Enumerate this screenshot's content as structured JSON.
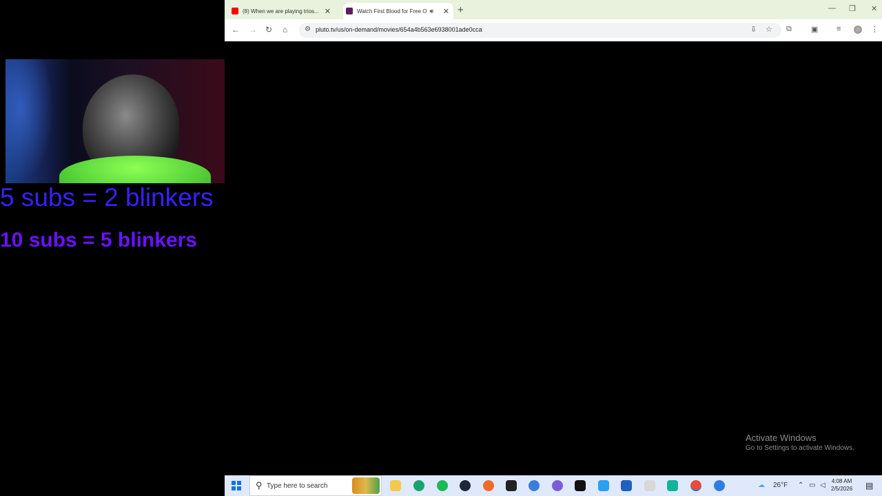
{
  "overlay": {
    "line1": "5 subs = 2 blinkers",
    "line2": "10 subs = 5 blinkers"
  },
  "browser": {
    "tabs": [
      {
        "title": "(8) When we are playing trios...",
        "favicon": "youtube-icon",
        "active": false
      },
      {
        "title": "Watch First Blood for Free O",
        "favicon": "pluto-tv-icon",
        "active": true
      }
    ],
    "address": "pluto.tv/us/on-demand/movies/654a4b563e6938001ade0cca"
  },
  "watermark": {
    "title": "Activate Windows",
    "subtitle": "Go to Settings to activate Windows."
  },
  "taskbar": {
    "search_placeholder": "Type here to search",
    "weather": "26°F",
    "time": "4:08 AM",
    "date": "2/5/2026"
  },
  "colors": {
    "overlay_line1": "#3a1fff",
    "overlay_line2": "#6a12ff",
    "tabbar_bg": "#e8f2dd",
    "taskbar_bg": "#dfe9fb"
  }
}
